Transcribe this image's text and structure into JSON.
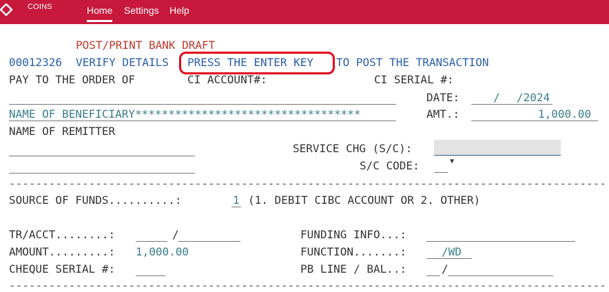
{
  "app": {
    "brand": "COINS",
    "logo_icon": "diamond-logo-icon"
  },
  "nav": {
    "home": "Home",
    "settings": "Settings",
    "help": "Help"
  },
  "form": {
    "title": "POST/PRINT BANK DRAFT",
    "status_ref": "00012326",
    "verify": "VERIFY DETAILS",
    "press_enter": "PRESS THE ENTER KEY",
    "to_post": "TO POST THE TRANSACTION",
    "pay_to": "PAY TO THE ORDER OF",
    "ci_account": "CI ACCOUNT#:",
    "ci_serial": "CI SERIAL #:",
    "date_label": "DATE:",
    "date_sep1": "/",
    "date_sep2": "/2024",
    "beneficiary": "NAME OF BENEFICIARY**********************************",
    "amt_label": "AMT.:",
    "amt_value": "1,000.00",
    "remitter_label": "NAME OF REMITTER",
    "service_chg": "SERVICE CHG (S/C):",
    "sc_code": "S/C CODE:",
    "dashes": "-------------------------------------------------------------------------------------------------------",
    "source_funds": "SOURCE OF FUNDS..........:",
    "source_value": "1",
    "source_desc": "(1. DEBIT CIBC ACCOUNT OR 2. OTHER)",
    "tr_acct": "TR/ACCT........:",
    "tr_sep": "/",
    "funding_info": "FUNDING INFO...:",
    "amount_label": "AMOUNT.........:",
    "amount_value": "1,000.00",
    "function_label": "FUNCTION.......:",
    "function_value": "/WD",
    "cheque_serial": "CHEQUE SERIAL #:",
    "pb_line": "PB LINE / BAL..:",
    "pb_sep": "/"
  }
}
